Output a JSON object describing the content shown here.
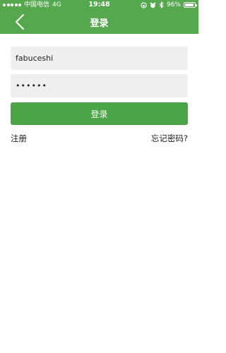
{
  "status_bar": {
    "carrier": "中国电信",
    "network": "4G",
    "time": "19:48",
    "battery_percent": "96%",
    "battery_level": 0.96
  },
  "header": {
    "title": "登录",
    "bg_color": "#56a84f"
  },
  "form": {
    "username_value": "fabuceshi",
    "password_value": "••••••",
    "submit_label": "登录",
    "submit_color": "#49a545"
  },
  "links": {
    "register": "注册",
    "forgot_password": "忘记密码?"
  }
}
